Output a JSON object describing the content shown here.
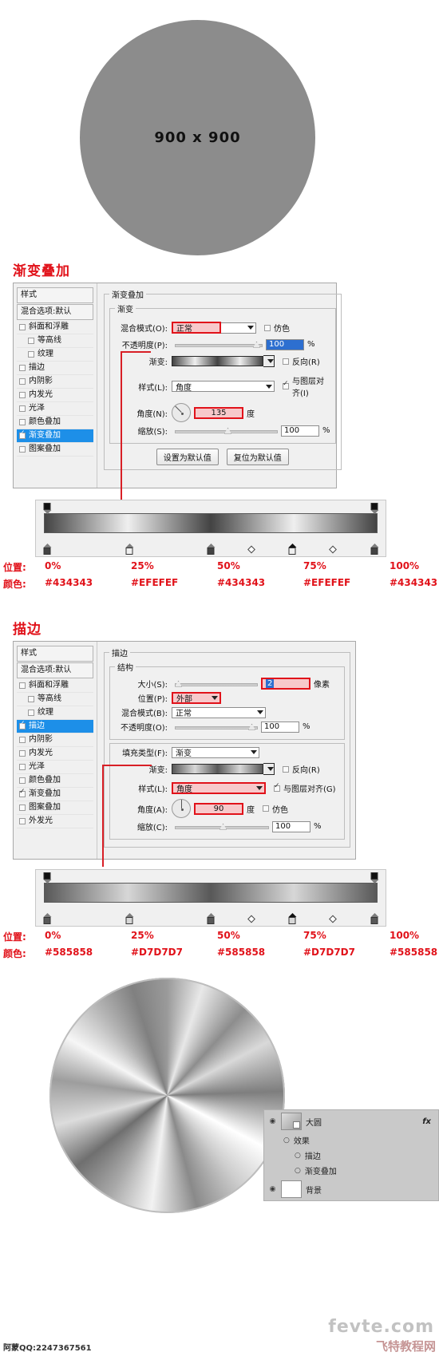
{
  "top_preview": {
    "label": "900 x 900"
  },
  "sections": [
    {
      "heading": "渐变叠加",
      "styles_panel": {
        "title": "样式",
        "blending": "混合选项:默认",
        "items": [
          {
            "label": "斜面和浮雕",
            "checked": false,
            "sub": false,
            "selected": false
          },
          {
            "label": "等高线",
            "checked": false,
            "sub": true,
            "selected": false
          },
          {
            "label": "纹理",
            "checked": false,
            "sub": true,
            "selected": false
          },
          {
            "label": "描边",
            "checked": false,
            "sub": false,
            "selected": false
          },
          {
            "label": "内阴影",
            "checked": false,
            "sub": false,
            "selected": false
          },
          {
            "label": "内发光",
            "checked": false,
            "sub": false,
            "selected": false
          },
          {
            "label": "光泽",
            "checked": false,
            "sub": false,
            "selected": false
          },
          {
            "label": "颜色叠加",
            "checked": false,
            "sub": false,
            "selected": false
          },
          {
            "label": "渐变叠加",
            "checked": true,
            "sub": false,
            "selected": true
          },
          {
            "label": "图案叠加",
            "checked": false,
            "sub": false,
            "selected": false
          }
        ]
      },
      "group_title": "渐变叠加",
      "sub_group_title": "渐变",
      "fields": {
        "blend_mode_label": "混合模式(O):",
        "blend_mode_value": "正常",
        "dither_label": "仿色",
        "opacity_label": "不透明度(P):",
        "opacity_value": "100",
        "opacity_unit": "%",
        "gradient_label": "渐变:",
        "reverse_label": "反向(R)",
        "style_label": "样式(L):",
        "style_value": "角度",
        "align_label": "与图层对齐(I)",
        "angle_label": "角度(N):",
        "angle_value": "135",
        "angle_unit": "度",
        "scale_label": "缩放(S):",
        "scale_value": "100",
        "scale_unit": "%"
      },
      "buttons": {
        "set_default": "设置为默认值",
        "reset_default": "复位为默认值"
      },
      "gradient_stops": {
        "position_label": "位置:",
        "color_label": "颜色:",
        "positions": [
          "0%",
          "25%",
          "50%",
          "75%",
          "100%"
        ],
        "colors": [
          "#434343",
          "#EFEFEF",
          "#434343",
          "#EFEFEF",
          "#434343"
        ]
      }
    },
    {
      "heading": "描边",
      "styles_panel": {
        "title": "样式",
        "blending": "混合选项:默认",
        "items": [
          {
            "label": "斜面和浮雕",
            "checked": false,
            "sub": false,
            "selected": false
          },
          {
            "label": "等高线",
            "checked": false,
            "sub": true,
            "selected": false
          },
          {
            "label": "纹理",
            "checked": false,
            "sub": true,
            "selected": false
          },
          {
            "label": "描边",
            "checked": true,
            "sub": false,
            "selected": true
          },
          {
            "label": "内阴影",
            "checked": false,
            "sub": false,
            "selected": false
          },
          {
            "label": "内发光",
            "checked": false,
            "sub": false,
            "selected": false
          },
          {
            "label": "光泽",
            "checked": false,
            "sub": false,
            "selected": false
          },
          {
            "label": "颜色叠加",
            "checked": false,
            "sub": false,
            "selected": false
          },
          {
            "label": "渐变叠加",
            "checked": true,
            "sub": false,
            "selected": false
          },
          {
            "label": "图案叠加",
            "checked": false,
            "sub": false,
            "selected": false
          },
          {
            "label": "外发光",
            "checked": false,
            "sub": false,
            "selected": false
          }
        ]
      },
      "group_title": "描边",
      "sub_group_title": "结构",
      "fields": {
        "size_label": "大小(S):",
        "size_value": "2",
        "size_unit": "像素",
        "position_label": "位置(P):",
        "position_value": "外部",
        "blend_mode_label": "混合模式(B):",
        "blend_mode_value": "正常",
        "opacity_label": "不透明度(O):",
        "opacity_value": "100",
        "opacity_unit": "%",
        "fill_type_label": "填充类型(F):",
        "fill_type_value": "渐变",
        "gradient_label": "渐变:",
        "reverse_label": "反向(R)",
        "style_label": "样式(L):",
        "style_value": "角度",
        "align_label": "与图层对齐(G)",
        "angle_label": "角度(A):",
        "angle_value": "90",
        "angle_unit": "度",
        "dither_label": "仿色",
        "scale_label": "缩放(C):",
        "scale_value": "100",
        "scale_unit": "%"
      },
      "gradient_stops": {
        "position_label": "位置:",
        "color_label": "颜色:",
        "positions": [
          "0%",
          "25%",
          "50%",
          "75%",
          "100%"
        ],
        "colors": [
          "#585858",
          "#D7D7D7",
          "#585858",
          "#D7D7D7",
          "#585858"
        ]
      }
    }
  ],
  "layers_panel": {
    "layer_name": "大圆",
    "fx_badge": "fx",
    "effects_label": "效果",
    "effect_items": [
      "描边",
      "渐变叠加"
    ],
    "bottom_layer_name": "背景"
  },
  "watermarks": {
    "left": "阿蒙QQ:2247367561",
    "right": "fevte.com",
    "right2": "飞特教程网"
  }
}
